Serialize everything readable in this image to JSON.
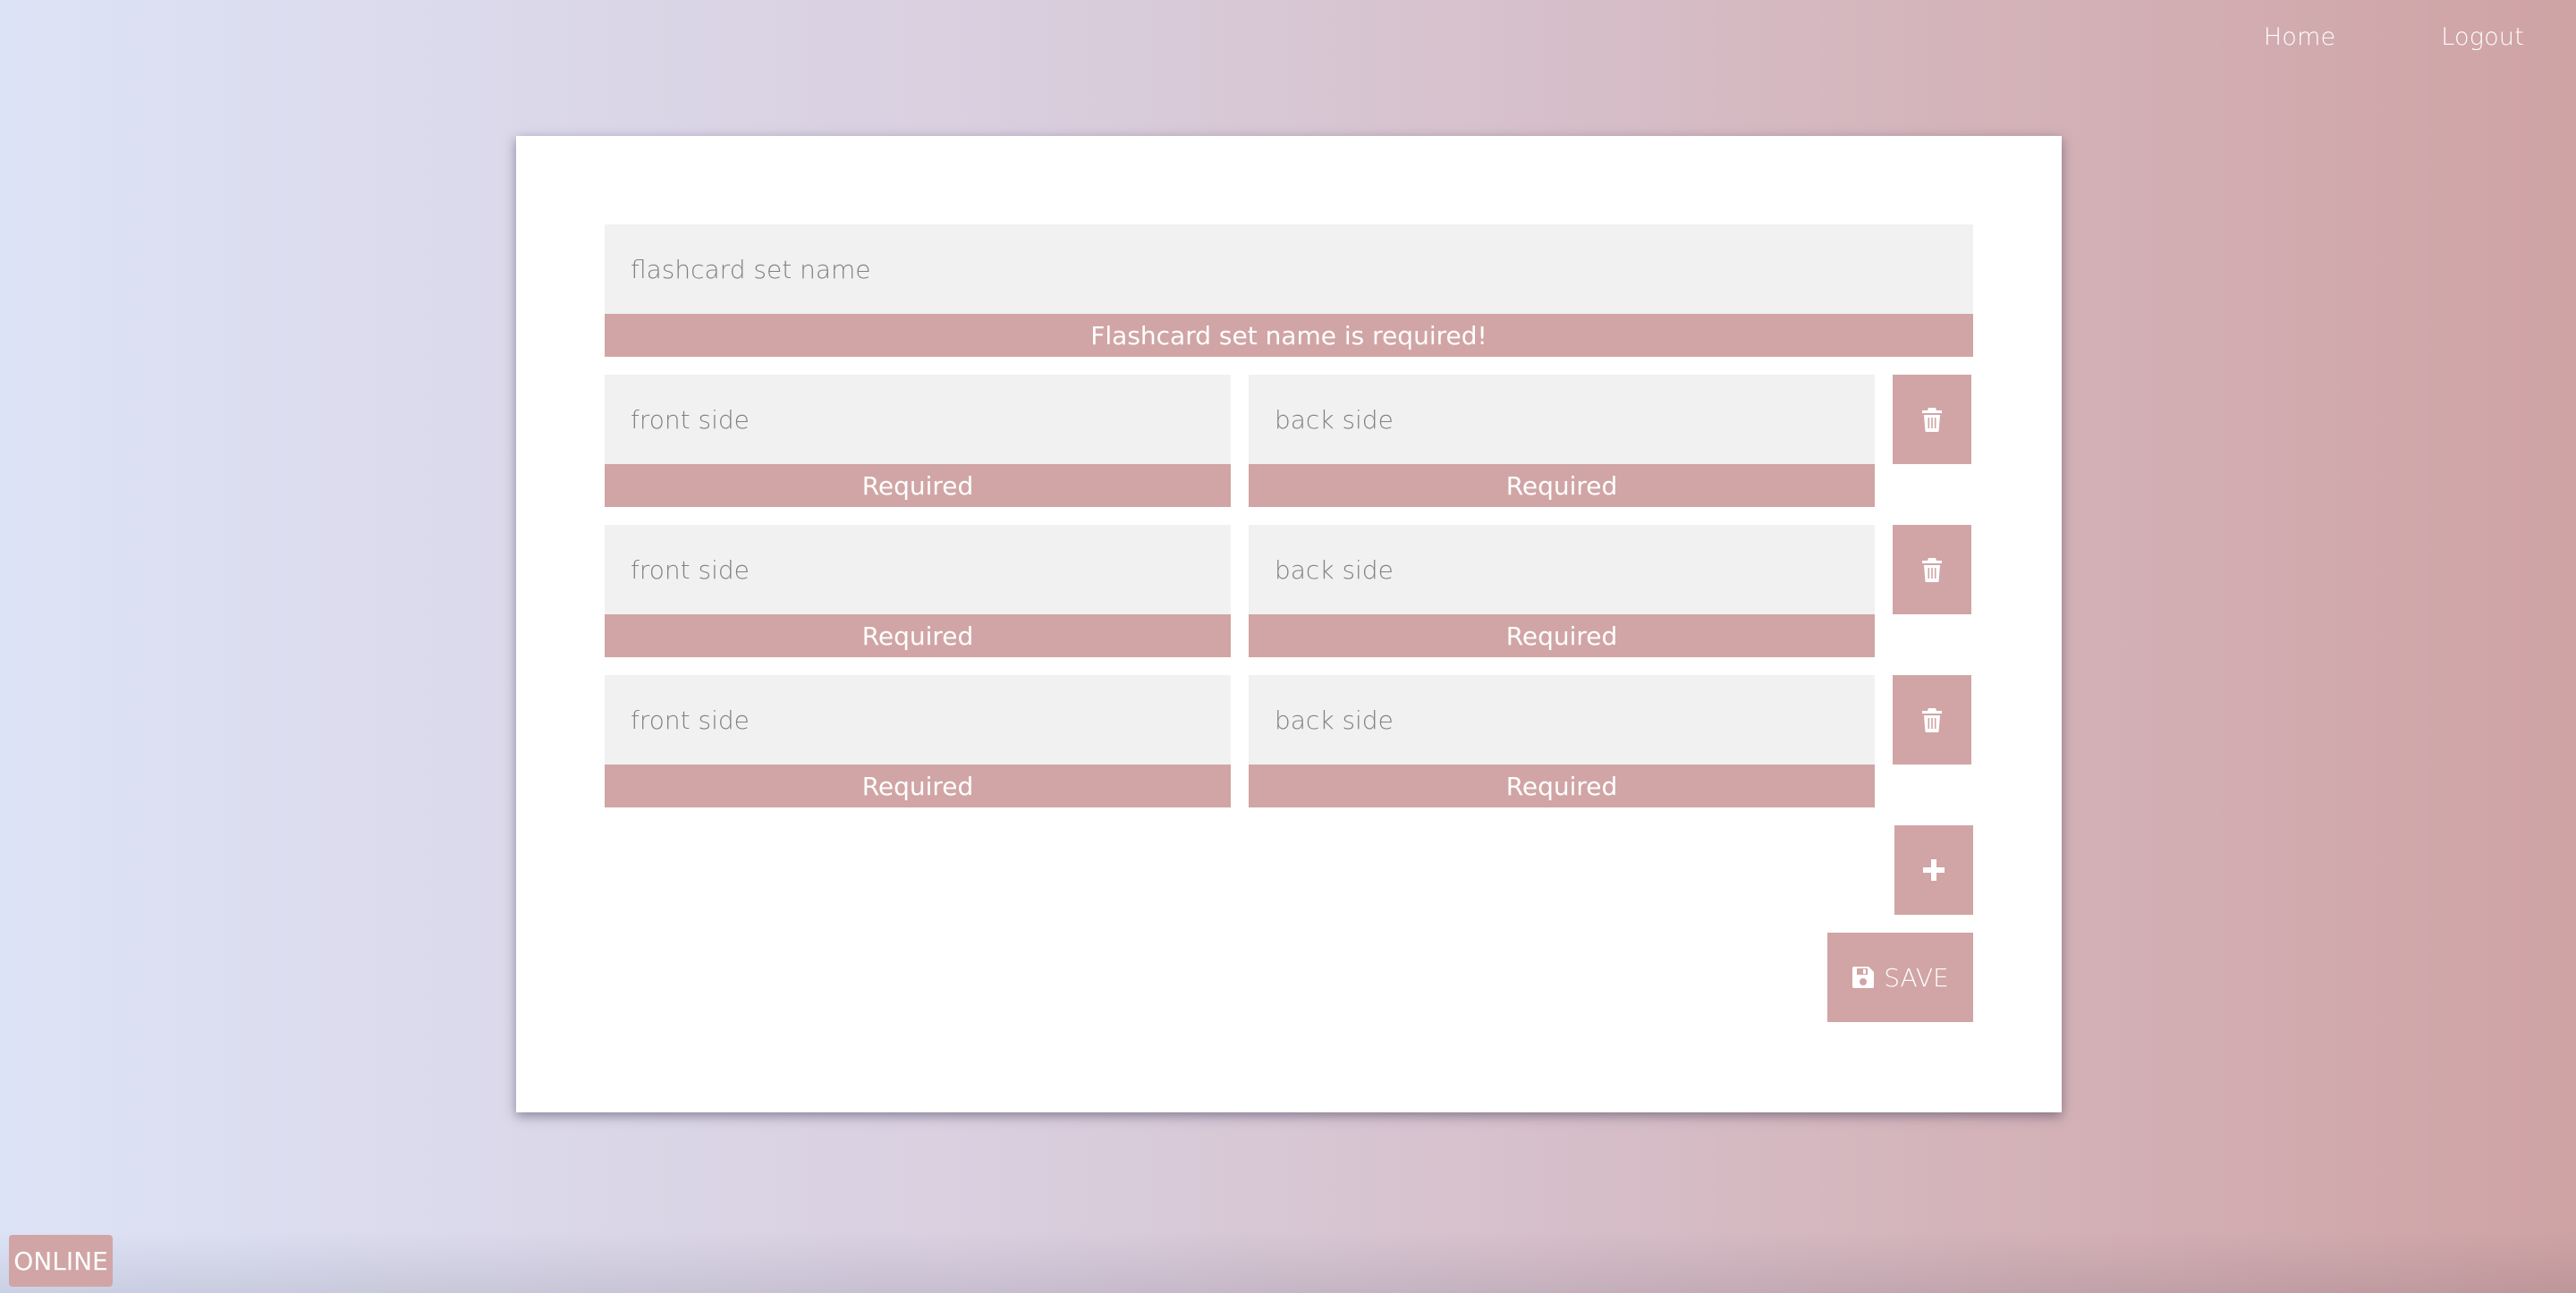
{
  "nav": {
    "home_label": "Home",
    "logout_label": "Logout"
  },
  "form": {
    "set_name": {
      "value": "",
      "placeholder": "flashcard set name",
      "error": "Flashcard set name is required!"
    },
    "cards": [
      {
        "front_placeholder": "front side",
        "front_error": "Required",
        "back_placeholder": "back side",
        "back_error": "Required"
      },
      {
        "front_placeholder": "front side",
        "front_error": "Required",
        "back_placeholder": "back side",
        "back_error": "Required"
      },
      {
        "front_placeholder": "front side",
        "front_error": "Required",
        "back_placeholder": "back side",
        "back_error": "Required"
      }
    ],
    "trash_icon": "trash-icon",
    "add_icon": "plus-icon",
    "save_icon": "floppy-disk-icon",
    "save_label": "SAVE"
  },
  "status": {
    "label": "ONLINE"
  },
  "colors": {
    "accent": "#d1a5a5",
    "field_bg": "#f1f1f1",
    "card_bg": "#ffffff"
  }
}
